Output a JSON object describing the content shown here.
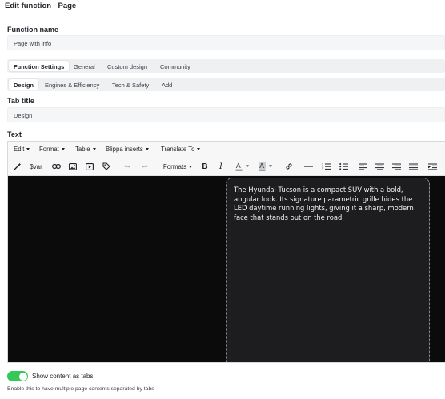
{
  "window": {
    "title": "Edit function - Page"
  },
  "function_name": {
    "label": "Function name",
    "value": "Page with info"
  },
  "main_tabs": [
    {
      "label": "Function Settings",
      "active": true
    },
    {
      "label": "General",
      "active": false
    },
    {
      "label": "Custom design",
      "active": false
    },
    {
      "label": "Community",
      "active": false
    }
  ],
  "sub_tabs": [
    {
      "label": "Design",
      "active": true
    },
    {
      "label": "Engines & Efficiency",
      "active": false
    },
    {
      "label": "Tech & Safety",
      "active": false
    },
    {
      "label": "Add",
      "active": false
    }
  ],
  "tab_title": {
    "label": "Tab title",
    "value": "Design"
  },
  "text_section": {
    "label": "Text"
  },
  "editor": {
    "menus": [
      "Edit",
      "Format",
      "Table",
      "Blippa inserts",
      "Translate To"
    ],
    "toolbar": {
      "var_label": "$var",
      "formats_label": "Formats"
    },
    "content_text": "The Hyundai Tucson is a compact SUV with a bold, angular look. Its signature parametric grille hides the LED daytime running lights, giving it a sharp, modern face that stands out on the road."
  },
  "show_tabs": {
    "label": "Show content as tabs",
    "enabled": true,
    "help": "Enable this to have multiple page contents separated by tabs"
  },
  "colors": {
    "toggle_on": "#34c759",
    "editor_bg": "#0b0b0c",
    "card_bg": "#1d1d1f"
  }
}
